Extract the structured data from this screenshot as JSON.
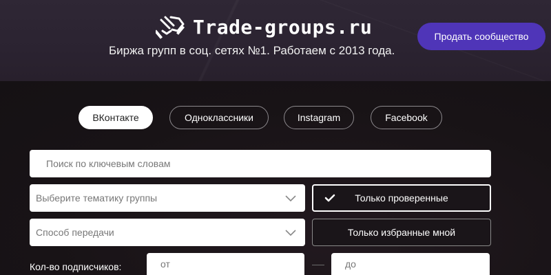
{
  "header": {
    "logo_text": "Trade-groups.ru",
    "tagline": "Биржа групп в соц. сетях №1. Работаем с 2013 года.",
    "sell_button": "Продать сообщество"
  },
  "tabs": [
    {
      "label": "ВКонтакте",
      "active": true
    },
    {
      "label": "Одноклассники",
      "active": false
    },
    {
      "label": "Instagram",
      "active": false
    },
    {
      "label": "Facebook",
      "active": false
    }
  ],
  "filters": {
    "search_placeholder": "Поиск по ключевым словам",
    "topic_select": "Выберите тематику группы",
    "transfer_select": "Способ передачи",
    "verified_only": "Только проверенные",
    "favorites_only": "Только избранные мной",
    "subscribers_label": "Кол-во подписчиков:",
    "from_placeholder": "от",
    "to_placeholder": "до"
  },
  "colors": {
    "accent": "#4f35b8",
    "header_bg": "#2c2432",
    "page_bg": "#1a1519"
  },
  "icons": {
    "logo": "handshake-icon",
    "select": "chevron-down-icon",
    "check": "checkmark-icon"
  }
}
